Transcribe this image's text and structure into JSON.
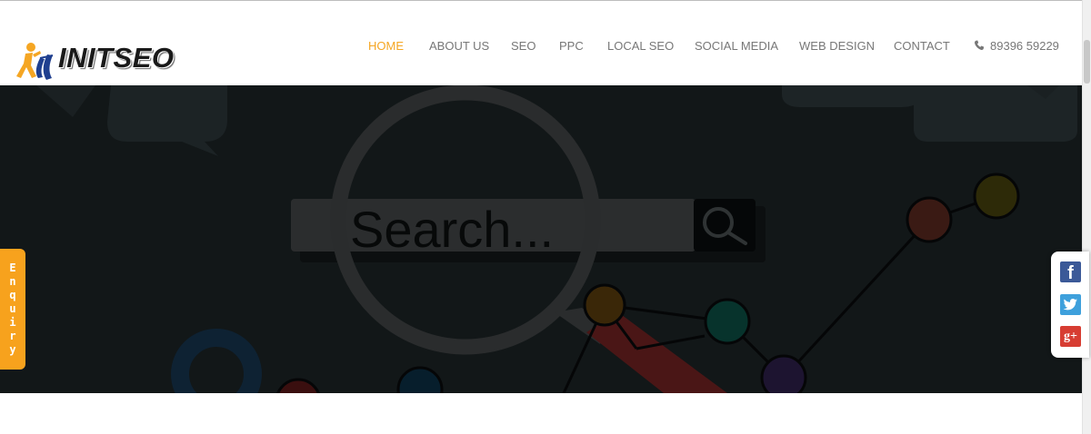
{
  "brand": {
    "logo_text": "INITSEO"
  },
  "nav": {
    "items": [
      {
        "label": "HOME",
        "active": true
      },
      {
        "label": "ABOUT US",
        "active": false
      },
      {
        "label": "SEO",
        "active": false
      },
      {
        "label": "PPC",
        "active": false
      },
      {
        "label": "LOCAL SEO",
        "active": false
      },
      {
        "label": "SOCIAL MEDIA",
        "active": false
      },
      {
        "label": "WEB DESIGN",
        "active": false
      },
      {
        "label": "CONTACT",
        "active": false
      }
    ],
    "phone": "89396 59229",
    "phone_icon": "phone-icon"
  },
  "hero": {
    "search_text": "Search...",
    "search_icon": "magnifier-icon"
  },
  "enquiry": {
    "label": "Enquiry"
  },
  "social": [
    {
      "name": "facebook",
      "glyph": "f",
      "color": "#3b5998"
    },
    {
      "name": "twitter",
      "glyph": "",
      "color": "#3ea0dc"
    },
    {
      "name": "google-plus",
      "glyph": "g+",
      "color": "#d73d32"
    }
  ],
  "colors": {
    "accent": "#f5a623",
    "nav_text": "#777777",
    "hero_bg": "#121718",
    "enquiry_bg": "#f7a21d"
  }
}
